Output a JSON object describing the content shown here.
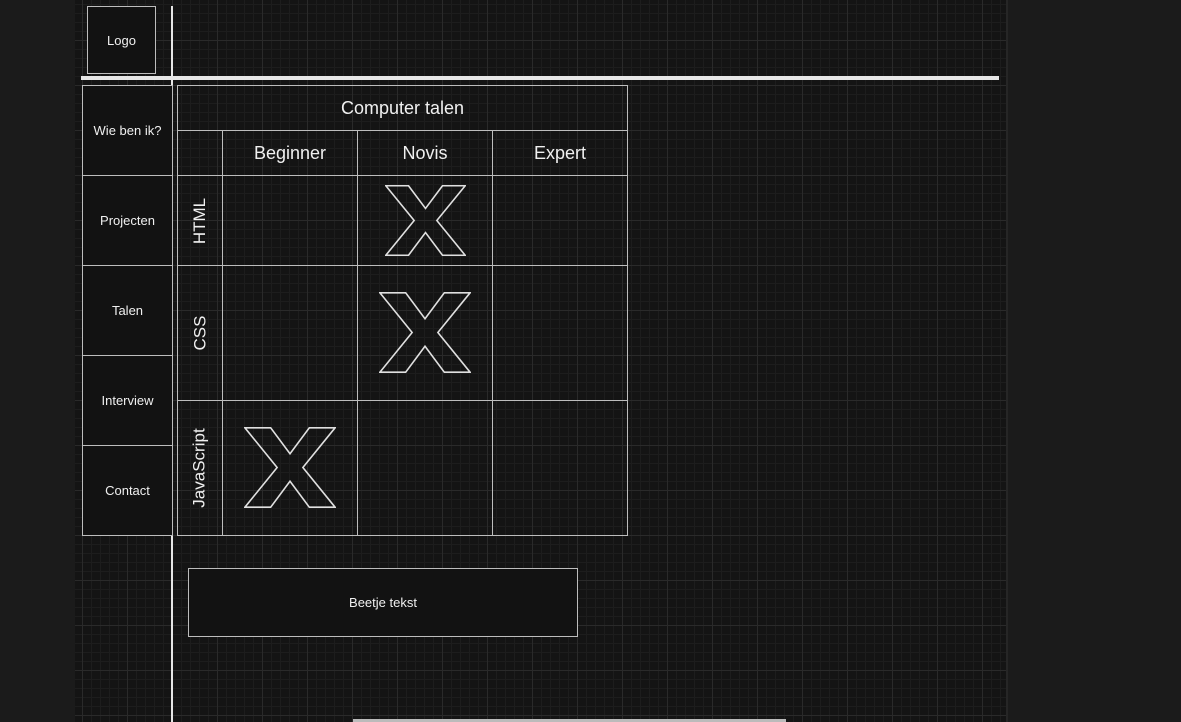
{
  "logo": "Logo",
  "nav": [
    "Wie ben ik?",
    "Projecten",
    "Talen",
    "Interview",
    "Contact"
  ],
  "table": {
    "title": "Computer talen",
    "columns": [
      "Beginner",
      "Novis",
      "Expert"
    ],
    "rows": [
      {
        "label": "HTML",
        "mark": "Novis"
      },
      {
        "label": "CSS",
        "mark": "Novis"
      },
      {
        "label": "JavaScript",
        "mark": "Beginner"
      }
    ]
  },
  "text_box": "Beetje tekst"
}
